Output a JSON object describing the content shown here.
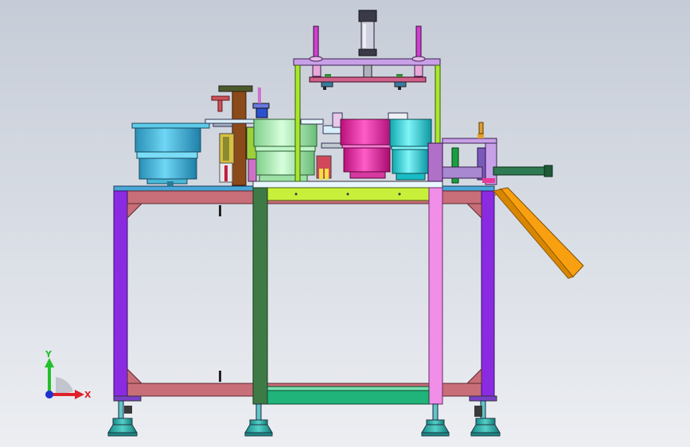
{
  "triad": {
    "y_label": "Y",
    "x_label": "X",
    "y_color": "#22c02a",
    "x_color": "#e0202a",
    "z_color": "#2030d0"
  },
  "colors": {
    "viewport_top": "#c6ccd7",
    "viewport_bottom": "#eceef2",
    "frame_leg_purple": "#8a2be2",
    "frame_rail_red": "#c86e78",
    "center_column_green": "#3e7a45",
    "center_column_pink": "#f08ee8",
    "tabletop_blue": "#48a8d8",
    "bowl_cyan": "#38b6d8",
    "bowl_light_green": "#a8f0b0",
    "bowl_magenta": "#e0209a",
    "bowl_teal": "#20d0d8",
    "chute_orange": "#f8a010",
    "top_plate_lilac": "#c8a0e8",
    "gantry_lime": "#a8e830"
  }
}
